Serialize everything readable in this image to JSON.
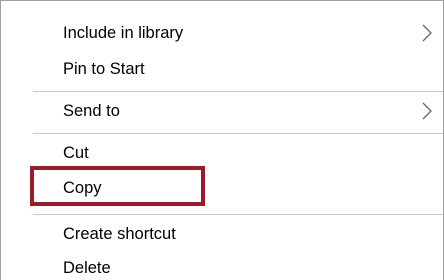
{
  "context_menu": {
    "items": [
      {
        "label": "Include in library",
        "submenu": true
      },
      {
        "label": "Pin to Start",
        "submenu": false
      },
      {
        "label": "Send to",
        "submenu": true
      },
      {
        "label": "Cut",
        "submenu": false
      },
      {
        "label": "Copy",
        "submenu": false,
        "highlighted": true
      },
      {
        "label": "Create shortcut",
        "submenu": false
      },
      {
        "label": "Delete",
        "submenu": false
      }
    ],
    "highlight_color": "#9c1b29",
    "separator_color": "#c8c8c8",
    "border_color": "#a0a0a0"
  }
}
